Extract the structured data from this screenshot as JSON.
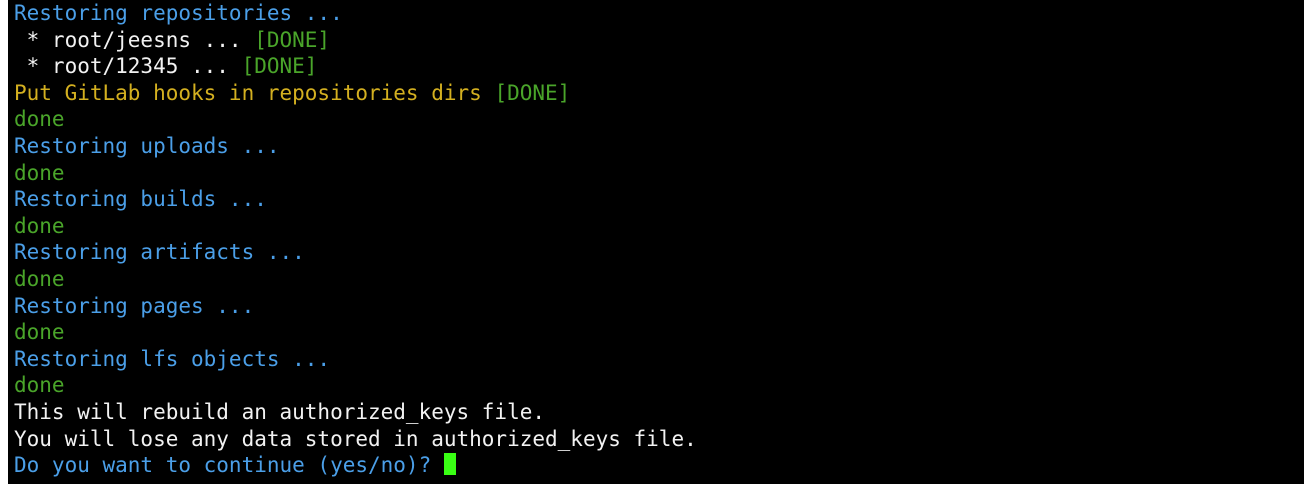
{
  "terminal": {
    "lines": [
      {
        "text": "Restoring repositories ...",
        "color": "#4b9fe8"
      },
      {
        "prefix": " * root/jeesns ... ",
        "status": "[DONE]"
      },
      {
        "prefix": " * root/12345 ... ",
        "status": "[DONE]"
      },
      {
        "prefix": "Put GitLab hooks in repositories dirs ",
        "status": "[DONE]"
      },
      {
        "text": "done",
        "color": "#4aa52a"
      },
      {
        "text": "Restoring uploads ...",
        "color": "#4b9fe8"
      },
      {
        "text": "done",
        "color": "#4aa52a"
      },
      {
        "text": "Restoring builds ...",
        "color": "#4b9fe8"
      },
      {
        "text": "done",
        "color": "#4aa52a"
      },
      {
        "text": "Restoring artifacts ...",
        "color": "#4b9fe8"
      },
      {
        "text": "done",
        "color": "#4aa52a"
      },
      {
        "text": "Restoring pages ...",
        "color": "#4b9fe8"
      },
      {
        "text": "done",
        "color": "#4aa52a"
      },
      {
        "text": "Restoring lfs objects ...",
        "color": "#4b9fe8"
      },
      {
        "text": "done",
        "color": "#4aa52a"
      },
      {
        "text": "This will rebuild an authorized_keys file.",
        "color": "#f2f2f2"
      },
      {
        "text": "You will lose any data stored in authorized_keys file.",
        "color": "#f2f2f2"
      },
      {
        "text": "Do you want to continue (yes/no)? ",
        "color": "#4b9fe8"
      }
    ],
    "colors": {
      "background": "#000000",
      "blue": "#4b9fe8",
      "white": "#f2f2f2",
      "yellow": "#d4b020",
      "green": "#4aa52a",
      "cursor": "#39ff14"
    }
  }
}
